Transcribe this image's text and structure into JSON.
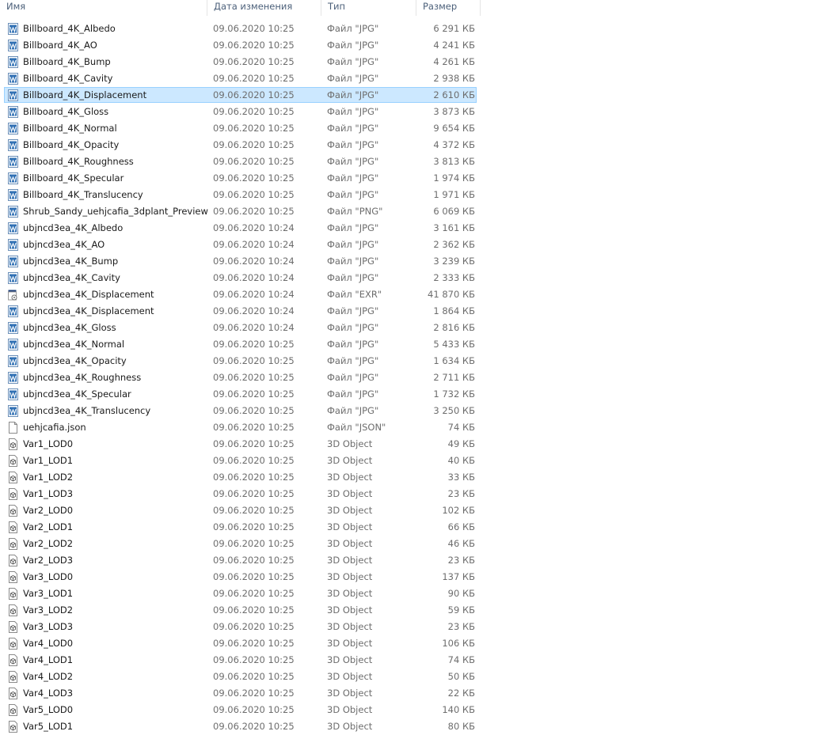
{
  "header": {
    "name": "Имя",
    "date": "Дата изменения",
    "type": "Тип",
    "size": "Размер"
  },
  "colors": {
    "selected_bg": "#cce8ff",
    "selected_border": "#99d1ff",
    "header_text": "#4c607a",
    "secondary_text": "#6d6d6d"
  },
  "files": [
    {
      "name": "Billboard_4K_Albedo",
      "date": "09.06.2020 10:25",
      "type": "Файл \"JPG\"",
      "size": "6 291 КБ",
      "icon": "jpg-image-icon"
    },
    {
      "name": "Billboard_4K_AO",
      "date": "09.06.2020 10:25",
      "type": "Файл \"JPG\"",
      "size": "4 241 КБ",
      "icon": "jpg-image-icon"
    },
    {
      "name": "Billboard_4K_Bump",
      "date": "09.06.2020 10:25",
      "type": "Файл \"JPG\"",
      "size": "4 261 КБ",
      "icon": "jpg-image-icon"
    },
    {
      "name": "Billboard_4K_Cavity",
      "date": "09.06.2020 10:25",
      "type": "Файл \"JPG\"",
      "size": "2 938 КБ",
      "icon": "jpg-image-icon"
    },
    {
      "name": "Billboard_4K_Displacement",
      "date": "09.06.2020 10:25",
      "type": "Файл \"JPG\"",
      "size": "2 610 КБ",
      "icon": "jpg-image-icon",
      "selected": true
    },
    {
      "name": "Billboard_4K_Gloss",
      "date": "09.06.2020 10:25",
      "type": "Файл \"JPG\"",
      "size": "3 873 КБ",
      "icon": "jpg-image-icon"
    },
    {
      "name": "Billboard_4K_Normal",
      "date": "09.06.2020 10:25",
      "type": "Файл \"JPG\"",
      "size": "9 654 КБ",
      "icon": "jpg-image-icon"
    },
    {
      "name": "Billboard_4K_Opacity",
      "date": "09.06.2020 10:25",
      "type": "Файл \"JPG\"",
      "size": "4 372 КБ",
      "icon": "jpg-image-icon"
    },
    {
      "name": "Billboard_4K_Roughness",
      "date": "09.06.2020 10:25",
      "type": "Файл \"JPG\"",
      "size": "3 813 КБ",
      "icon": "jpg-image-icon"
    },
    {
      "name": "Billboard_4K_Specular",
      "date": "09.06.2020 10:25",
      "type": "Файл \"JPG\"",
      "size": "1 974 КБ",
      "icon": "jpg-image-icon"
    },
    {
      "name": "Billboard_4K_Translucency",
      "date": "09.06.2020 10:25",
      "type": "Файл \"JPG\"",
      "size": "1 971 КБ",
      "icon": "jpg-image-icon"
    },
    {
      "name": "Shrub_Sandy_uehjcafia_3dplant_Preview",
      "date": "09.06.2020 10:25",
      "type": "Файл \"PNG\"",
      "size": "6 069 КБ",
      "icon": "jpg-image-icon"
    },
    {
      "name": "ubjncd3ea_4K_Albedo",
      "date": "09.06.2020 10:24",
      "type": "Файл \"JPG\"",
      "size": "3 161 КБ",
      "icon": "jpg-image-icon"
    },
    {
      "name": "ubjncd3ea_4K_AO",
      "date": "09.06.2020 10:24",
      "type": "Файл \"JPG\"",
      "size": "2 362 КБ",
      "icon": "jpg-image-icon"
    },
    {
      "name": "ubjncd3ea_4K_Bump",
      "date": "09.06.2020 10:24",
      "type": "Файл \"JPG\"",
      "size": "3 239 КБ",
      "icon": "jpg-image-icon"
    },
    {
      "name": "ubjncd3ea_4K_Cavity",
      "date": "09.06.2020 10:24",
      "type": "Файл \"JPG\"",
      "size": "2 333 КБ",
      "icon": "jpg-image-icon"
    },
    {
      "name": "ubjncd3ea_4K_Displacement",
      "date": "09.06.2020 10:24",
      "type": "Файл \"EXR\"",
      "size": "41 870 КБ",
      "icon": "exr-file-icon"
    },
    {
      "name": "ubjncd3ea_4K_Displacement",
      "date": "09.06.2020 10:24",
      "type": "Файл \"JPG\"",
      "size": "1 864 КБ",
      "icon": "jpg-image-icon"
    },
    {
      "name": "ubjncd3ea_4K_Gloss",
      "date": "09.06.2020 10:24",
      "type": "Файл \"JPG\"",
      "size": "2 816 КБ",
      "icon": "jpg-image-icon"
    },
    {
      "name": "ubjncd3ea_4K_Normal",
      "date": "09.06.2020 10:25",
      "type": "Файл \"JPG\"",
      "size": "5 433 КБ",
      "icon": "jpg-image-icon"
    },
    {
      "name": "ubjncd3ea_4K_Opacity",
      "date": "09.06.2020 10:25",
      "type": "Файл \"JPG\"",
      "size": "1 634 КБ",
      "icon": "jpg-image-icon"
    },
    {
      "name": "ubjncd3ea_4K_Roughness",
      "date": "09.06.2020 10:25",
      "type": "Файл \"JPG\"",
      "size": "2 711 КБ",
      "icon": "jpg-image-icon"
    },
    {
      "name": "ubjncd3ea_4K_Specular",
      "date": "09.06.2020 10:25",
      "type": "Файл \"JPG\"",
      "size": "1 732 КБ",
      "icon": "jpg-image-icon"
    },
    {
      "name": "ubjncd3ea_4K_Translucency",
      "date": "09.06.2020 10:25",
      "type": "Файл \"JPG\"",
      "size": "3 250 КБ",
      "icon": "jpg-image-icon"
    },
    {
      "name": "uehjcafia.json",
      "date": "09.06.2020 10:25",
      "type": "Файл \"JSON\"",
      "size": "74 КБ",
      "icon": "blank-file-icon"
    },
    {
      "name": "Var1_LOD0",
      "date": "09.06.2020 10:25",
      "type": "3D Object",
      "size": "49 КБ",
      "icon": "3d-object-icon"
    },
    {
      "name": "Var1_LOD1",
      "date": "09.06.2020 10:25",
      "type": "3D Object",
      "size": "40 КБ",
      "icon": "3d-object-icon"
    },
    {
      "name": "Var1_LOD2",
      "date": "09.06.2020 10:25",
      "type": "3D Object",
      "size": "33 КБ",
      "icon": "3d-object-icon"
    },
    {
      "name": "Var1_LOD3",
      "date": "09.06.2020 10:25",
      "type": "3D Object",
      "size": "23 КБ",
      "icon": "3d-object-icon"
    },
    {
      "name": "Var2_LOD0",
      "date": "09.06.2020 10:25",
      "type": "3D Object",
      "size": "102 КБ",
      "icon": "3d-object-icon"
    },
    {
      "name": "Var2_LOD1",
      "date": "09.06.2020 10:25",
      "type": "3D Object",
      "size": "66 КБ",
      "icon": "3d-object-icon"
    },
    {
      "name": "Var2_LOD2",
      "date": "09.06.2020 10:25",
      "type": "3D Object",
      "size": "46 КБ",
      "icon": "3d-object-icon"
    },
    {
      "name": "Var2_LOD3",
      "date": "09.06.2020 10:25",
      "type": "3D Object",
      "size": "23 КБ",
      "icon": "3d-object-icon"
    },
    {
      "name": "Var3_LOD0",
      "date": "09.06.2020 10:25",
      "type": "3D Object",
      "size": "137 КБ",
      "icon": "3d-object-icon"
    },
    {
      "name": "Var3_LOD1",
      "date": "09.06.2020 10:25",
      "type": "3D Object",
      "size": "90 КБ",
      "icon": "3d-object-icon"
    },
    {
      "name": "Var3_LOD2",
      "date": "09.06.2020 10:25",
      "type": "3D Object",
      "size": "59 КБ",
      "icon": "3d-object-icon"
    },
    {
      "name": "Var3_LOD3",
      "date": "09.06.2020 10:25",
      "type": "3D Object",
      "size": "23 КБ",
      "icon": "3d-object-icon"
    },
    {
      "name": "Var4_LOD0",
      "date": "09.06.2020 10:25",
      "type": "3D Object",
      "size": "106 КБ",
      "icon": "3d-object-icon"
    },
    {
      "name": "Var4_LOD1",
      "date": "09.06.2020 10:25",
      "type": "3D Object",
      "size": "74 КБ",
      "icon": "3d-object-icon"
    },
    {
      "name": "Var4_LOD2",
      "date": "09.06.2020 10:25",
      "type": "3D Object",
      "size": "50 КБ",
      "icon": "3d-object-icon"
    },
    {
      "name": "Var4_LOD3",
      "date": "09.06.2020 10:25",
      "type": "3D Object",
      "size": "22 КБ",
      "icon": "3d-object-icon"
    },
    {
      "name": "Var5_LOD0",
      "date": "09.06.2020 10:25",
      "type": "3D Object",
      "size": "140 КБ",
      "icon": "3d-object-icon"
    },
    {
      "name": "Var5_LOD1",
      "date": "09.06.2020 10:25",
      "type": "3D Object",
      "size": "80 КБ",
      "icon": "3d-object-icon"
    }
  ]
}
